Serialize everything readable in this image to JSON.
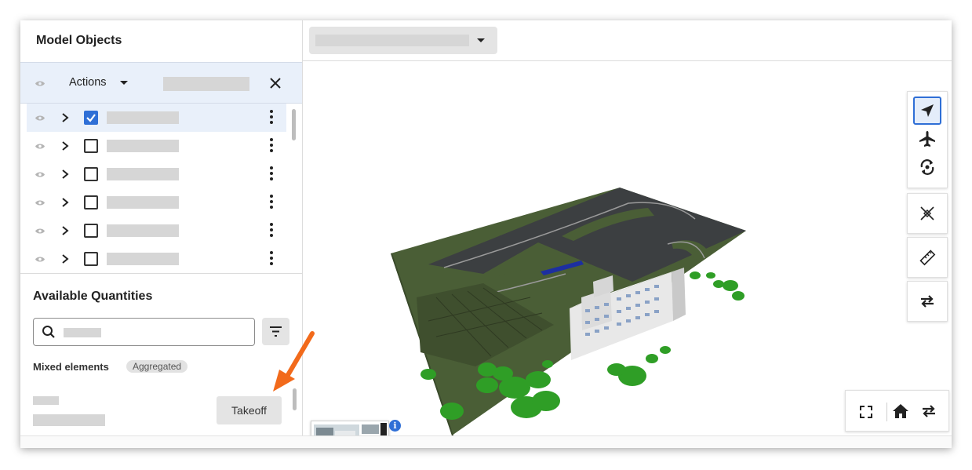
{
  "left_panel": {
    "title": "Model Objects",
    "actions_label": "Actions",
    "rows": [
      {
        "checked": true
      },
      {
        "checked": false
      },
      {
        "checked": false
      },
      {
        "checked": false
      },
      {
        "checked": false
      },
      {
        "checked": false
      }
    ]
  },
  "quantities": {
    "title": "Available Quantities",
    "search_placeholder": "",
    "group_label": "Mixed elements",
    "group_badge": "Aggregated",
    "takeoff_label": "Takeoff"
  },
  "viewer": {
    "info_glyph": "i"
  },
  "colors": {
    "accent": "#2f6fd6",
    "selection_bg": "#e9f0fa",
    "annotation_arrow": "#f26a1b",
    "terrain": "#4a5e36",
    "road": "#3c3f41"
  },
  "icons": {
    "select_tool": "navigation-arrow-icon",
    "fly_tool": "airplane-icon",
    "orbit_tool": "orbit-icon",
    "section_tool": "section-cut-icon",
    "measure_tool": "ruler-icon",
    "swap_tool": "swap-arrows-icon",
    "fullscreen": "fullscreen-icon",
    "home": "home-icon",
    "swap": "swap-arrows-icon"
  }
}
